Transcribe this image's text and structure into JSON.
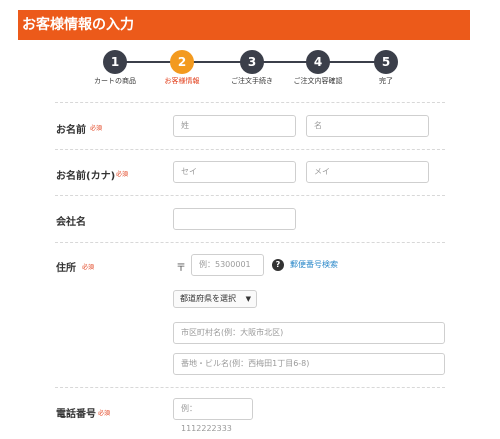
{
  "header": {
    "title": "お客様情報の入力"
  },
  "stepper": {
    "steps": [
      {
        "number": "1",
        "label": "カートの商品"
      },
      {
        "number": "2",
        "label": "お客様情報"
      },
      {
        "number": "3",
        "label": "ご注文手続き"
      },
      {
        "number": "4",
        "label": "ご注文内容確認"
      },
      {
        "number": "5",
        "label": "完了"
      }
    ],
    "active_step": 2
  },
  "required_label": "必須",
  "form": {
    "name": {
      "label": "お名前",
      "last_placeholder": "姓",
      "first_placeholder": "名"
    },
    "kana": {
      "label": "お名前(カナ)",
      "last_placeholder": "セイ",
      "first_placeholder": "メイ"
    },
    "company": {
      "label": "会社名",
      "placeholder": ""
    },
    "address": {
      "label": "住所",
      "postal_mark": "〒",
      "postal_placeholder": "例：5300001",
      "help_icon": "?",
      "lookup_link": "郵便番号検索",
      "prefecture_select": "都道府県を選択",
      "city_placeholder": "市区町村名(例：大阪市北区)",
      "street_placeholder": "番地・ビル名(例：西梅田1丁目6-8)"
    },
    "phone": {
      "label": "電話番号",
      "placeholder": "例：1112222333"
    }
  },
  "colors": {
    "accent": "#ec5a1a",
    "active_step": "#f39a1f",
    "step": "#3b3f4a",
    "required": "#e2401d",
    "link": "#2a88c9"
  }
}
